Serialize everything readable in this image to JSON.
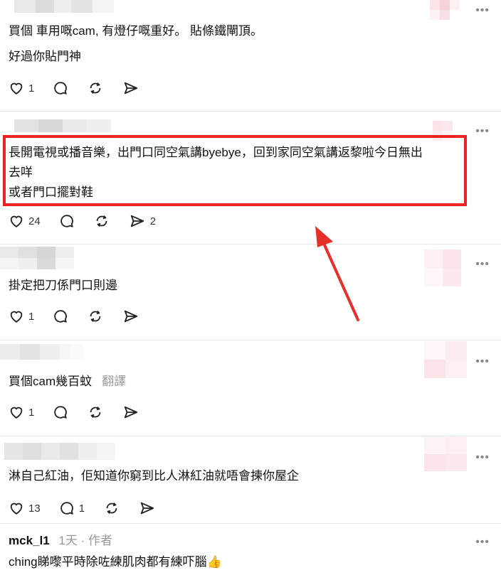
{
  "comments": [
    {
      "id": "c1",
      "lines": [
        "買個 車用嘅cam, 有燈仔嘅重好。 貼條鐵閘頂。",
        "好過你貼門神"
      ],
      "likes": "1",
      "replies": "",
      "reposts": "",
      "shares": ""
    },
    {
      "id": "c2",
      "lines": [
        "長開電視或播音樂，出門口同空氣講byebye，回到家同空氣講返黎啦今日無出",
        "去咩",
        "或者門口擺對鞋"
      ],
      "likes": "24",
      "replies": "",
      "reposts": "",
      "shares": "2"
    },
    {
      "id": "c3",
      "lines": [
        "掛定把刀係門口則邊"
      ],
      "likes": "1",
      "replies": "",
      "reposts": "",
      "shares": ""
    },
    {
      "id": "c4",
      "lines": [
        "買個cam幾百蚊"
      ],
      "translate_label": "翻譯",
      "likes": "1",
      "replies": "",
      "reposts": "",
      "shares": ""
    },
    {
      "id": "c5",
      "lines": [
        "淋自己紅油，佢知道你窮到比人淋紅油就唔會揀你屋企"
      ],
      "likes": "13",
      "replies": "1",
      "reposts": "",
      "shares": ""
    },
    {
      "id": "c6",
      "username": "mck_l1",
      "time": "1天",
      "separator": "·",
      "author_tag": "作者",
      "lines": [
        "ching睇嚟平時除咗練肌肉都有練吓腦👍"
      ]
    }
  ],
  "more_label": "•••",
  "colors": {
    "highlight": "#ee2222",
    "arrow": "#e8302a"
  }
}
